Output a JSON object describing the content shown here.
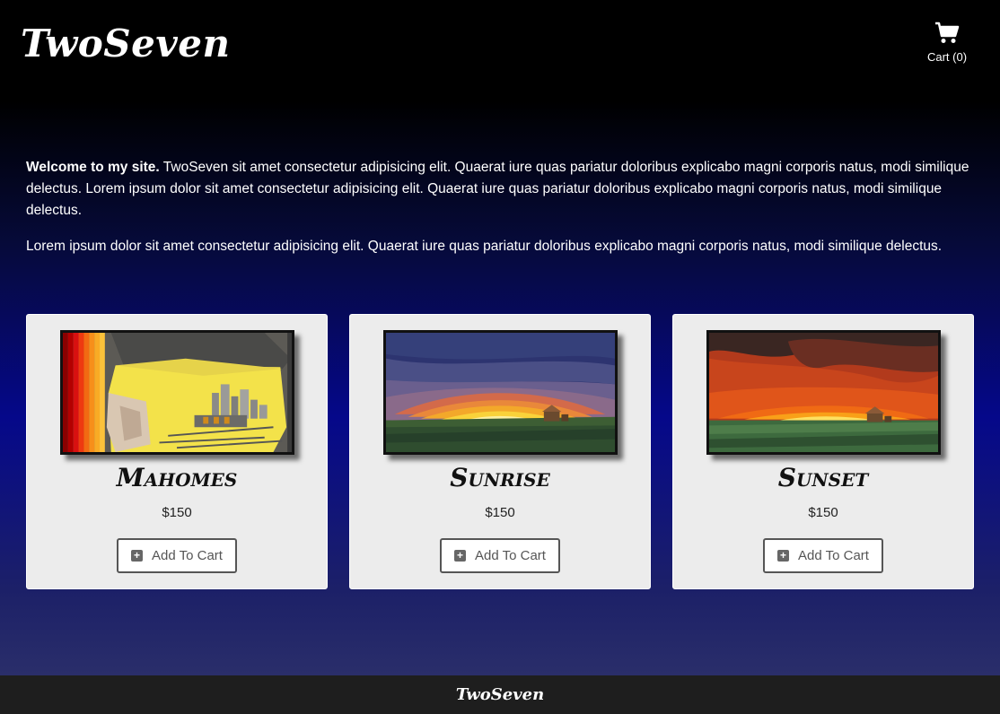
{
  "header": {
    "logo": "TwoSeven",
    "cart_label": "Cart (0)",
    "cart_icon": "shopping-cart-icon"
  },
  "intro": {
    "welcome_bold": "Welcome to my site.",
    "para1_rest": " TwoSeven sit amet consectetur adipisicing elit. Quaerat iure quas pariatur doloribus explicabo magni corporis natus, modi similique delectus. Lorem ipsum dolor sit amet consectetur adipisicing elit. Quaerat iure quas pariatur doloribus explicabo magni corporis natus, modi similique delectus.",
    "para2": "Lorem ipsum dolor sit amet consectetur adipisicing elit. Quaerat iure quas pariatur doloribus explicabo magni corporis natus, modi similique delectus."
  },
  "products": [
    {
      "name": "Mahomes",
      "price": "$150",
      "button": "Add To Cart",
      "image": "mahomes-artwork"
    },
    {
      "name": "Sunrise",
      "price": "$150",
      "button": "Add To Cart",
      "image": "sunrise-artwork"
    },
    {
      "name": "Sunset",
      "price": "$150",
      "button": "Add To Cart",
      "image": "sunset-artwork"
    }
  ],
  "footer": {
    "logo": "TwoSeven"
  },
  "colors": {
    "header_bg": "#000000",
    "footer_bg": "#1e1e1e",
    "card_bg": "#ececec",
    "gradient_mid": "#05088a"
  }
}
